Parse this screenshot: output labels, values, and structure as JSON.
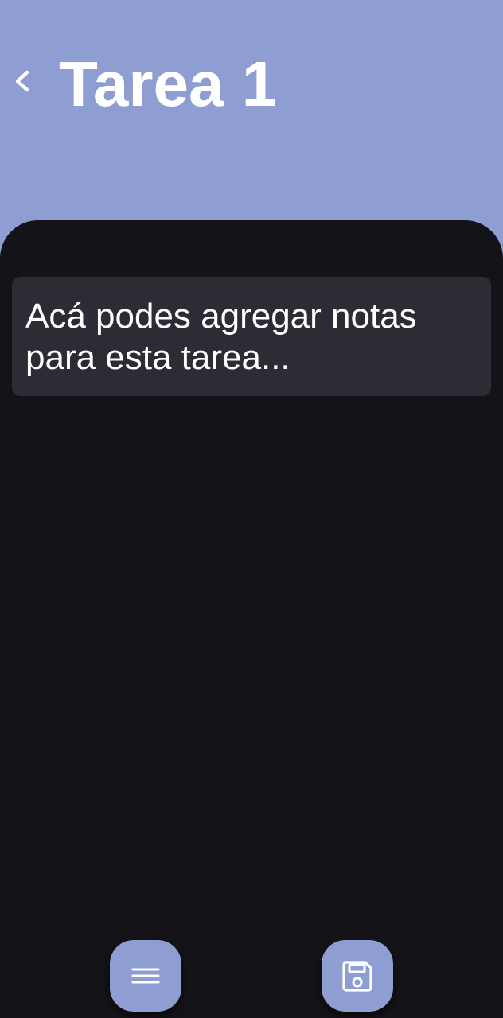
{
  "header": {
    "title": "Tarea 1",
    "back_icon": "chevron-left-icon"
  },
  "notes": {
    "placeholder": "Acá podes agregar notas para esta tarea..."
  },
  "fabs": {
    "menu_icon": "menu-icon",
    "save_icon": "save-icon"
  },
  "colors": {
    "header_background": "#8f9ed2",
    "content_background": "#141317",
    "notes_background": "#2c2c34",
    "fab_background": "#8f9ed2",
    "text": "#ffffff"
  }
}
